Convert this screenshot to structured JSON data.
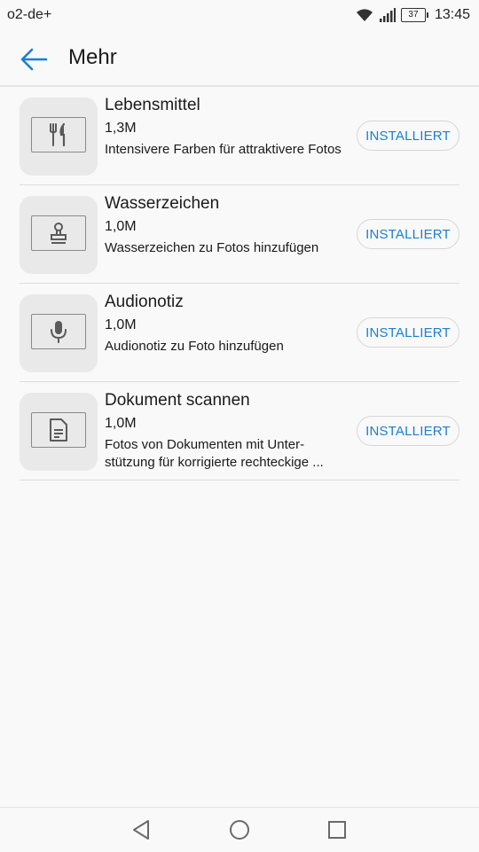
{
  "status_bar": {
    "carrier": "o2-de+",
    "battery": "37",
    "time": "13:45",
    "icons": [
      "wifi-icon",
      "signal-icon",
      "battery-icon"
    ]
  },
  "header": {
    "title": "Mehr",
    "back_icon": "back-arrow-icon"
  },
  "colors": {
    "accent": "#1a7fd4",
    "background": "#f9f9f9",
    "thumb_bg": "#e9e9e9"
  },
  "items": [
    {
      "name": "Lebensmittel",
      "size": "1,3M",
      "description": "Intensivere Farben für attraktivere Fotos",
      "button": "INSTALLIERT",
      "icon": "fork-knife-icon"
    },
    {
      "name": "Wasserzeichen",
      "size": "1,0M",
      "description": "Wasserzeichen zu Fotos hinzufügen",
      "button": "INSTALLIERT",
      "icon": "stamp-icon"
    },
    {
      "name": "Audionotiz",
      "size": "1,0M",
      "description": "Audionotiz zu Foto hinzufügen",
      "button": "INSTALLIERT",
      "icon": "microphone-icon"
    },
    {
      "name": "Dokument scannen",
      "size": "1,0M",
      "description": "Fotos von Dokumenten mit Unter-stützung für korrigierte rechteckige ...",
      "button": "INSTALLIERT",
      "icon": "document-icon"
    }
  ],
  "nav_bar": {
    "icons": [
      "nav-back-icon",
      "nav-home-icon",
      "nav-recents-icon"
    ]
  }
}
